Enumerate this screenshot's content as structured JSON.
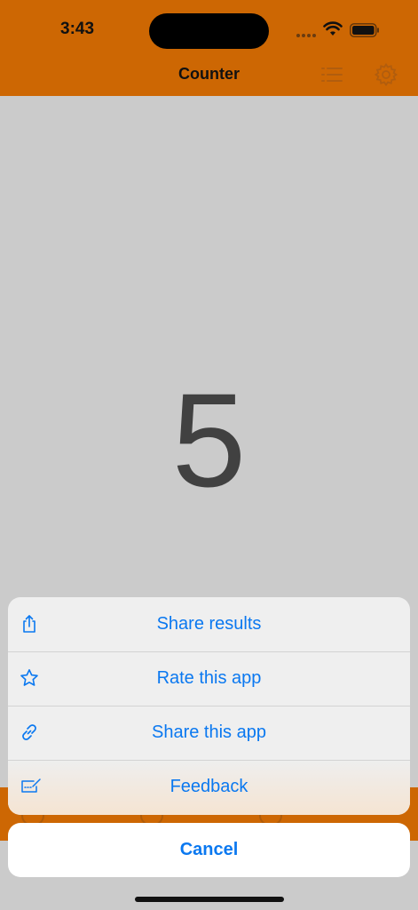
{
  "status_bar": {
    "time": "3:43"
  },
  "nav": {
    "title": "Counter",
    "icons": [
      "list-icon",
      "gear-icon"
    ]
  },
  "counter": {
    "value": "5"
  },
  "action_sheet": {
    "items": [
      {
        "label": "Share results",
        "icon": "share-icon"
      },
      {
        "label": "Rate this app",
        "icon": "star-icon"
      },
      {
        "label": "Share this app",
        "icon": "link-icon"
      },
      {
        "label": "Feedback",
        "icon": "feedback-icon"
      }
    ],
    "cancel_label": "Cancel"
  },
  "colors": {
    "accent": "#cd6703",
    "background": "#cbcbcb",
    "action_text": "#0a78f0",
    "counter_text": "#414141"
  }
}
